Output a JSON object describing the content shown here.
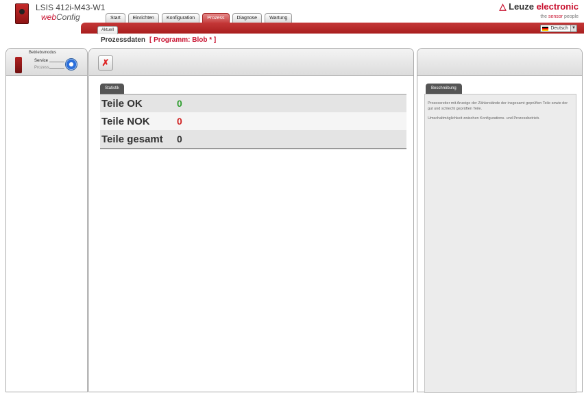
{
  "header": {
    "device_name": "LSIS 412i-M43-W1",
    "app_prefix": "web",
    "app_rest": "Config",
    "brand_name": "Leuze",
    "brand_suffix": "electronic",
    "tagline_pre": "the",
    "tagline_sensor": "sensor",
    "tagline_post": "people",
    "brand_color": "#c8102e"
  },
  "main_tabs": [
    {
      "label": "Start",
      "active": false
    },
    {
      "label": "Einrichten",
      "active": false
    },
    {
      "label": "Konfiguration",
      "active": false
    },
    {
      "label": "Prozess",
      "active": true
    },
    {
      "label": "Diagnose",
      "active": false
    },
    {
      "label": "Wartung",
      "active": false
    }
  ],
  "sub_tab": "Aktuell",
  "language": "Deutsch",
  "page_header": {
    "title": "Prozessdaten",
    "program": "[ Programm: Blob * ]"
  },
  "mode": {
    "title": "Betriebsmodus",
    "service": "Service",
    "prozess": "Prozess"
  },
  "stats": {
    "tab_label": "Statistik",
    "rows": [
      {
        "label": "Teile OK",
        "value": "0",
        "color": "#2c9c2c"
      },
      {
        "label": "Teile NOK",
        "value": "0",
        "color": "#d02020"
      },
      {
        "label": "Teile gesamt",
        "value": "0",
        "color": "#333333"
      }
    ]
  },
  "description": {
    "tab_label": "Beschreibung",
    "paragraph1": "Prozessreiter mit Anzeige der Zählerstände der insgesamt geprüften Teile sowie der gut und schlecht geprüften Teile.",
    "paragraph2": "Umschaltmöglichkeit zwischen Konfigurations- und Prozessbetrieb."
  },
  "icons": {
    "reset": "reset-counter-icon",
    "device": "device-icon",
    "mode_switch": "mode-switch-icon",
    "flag": "german-flag-icon"
  }
}
